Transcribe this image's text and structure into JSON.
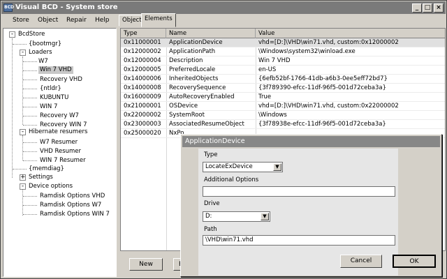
{
  "window": {
    "title": "Visual BCD - System store",
    "icon_text": "BCD",
    "icons": [
      "minimize-icon",
      "maximize-icon",
      "close-icon"
    ]
  },
  "menu": [
    "Store",
    "Object",
    "Repair",
    "Help"
  ],
  "tree": {
    "root": "BcdStore",
    "items": [
      {
        "label": "{bootmgr}"
      },
      {
        "label": "Loaders",
        "expander": "-",
        "children": [
          "W7",
          "Win 7 VHD",
          "Recovery VHD",
          "{ntldr}",
          "KUBUNTU",
          "WIN 7",
          "Recovery W7",
          "Recovery WIN 7"
        ]
      },
      {
        "label": "Hibernate resumers",
        "expander": "-",
        "children": [
          "W7 Resumer",
          "VHD Resumer",
          "WIN 7 Resumer"
        ]
      },
      {
        "label": "{memdiag}"
      },
      {
        "label": "Settings",
        "expander": "+"
      },
      {
        "label": "Device options",
        "expander": "-",
        "children": [
          "Ramdisk Options VHD",
          "Ramdisk Options W7",
          "Ramdisk Options WIN 7"
        ]
      }
    ],
    "selected": "Win 7 VHD"
  },
  "tabs": [
    "Object",
    "Elements"
  ],
  "active_tab": "Elements",
  "grid": {
    "columns": [
      "Type",
      "Name",
      "Value"
    ],
    "rows": [
      [
        "0x11000001",
        "ApplicationDevice",
        "vhd=[D:]\\VHD\\win71.vhd, custom:0x12000002"
      ],
      [
        "0x12000002",
        "ApplicationPath",
        "\\Windows\\system32\\winload.exe"
      ],
      [
        "0x12000004",
        "Description",
        "Win 7 VHD"
      ],
      [
        "0x12000005",
        "PreferredLocale",
        "en-US"
      ],
      [
        "0x14000006",
        "InheritedObjects",
        "{6efb52bf-1766-41db-a6b3-0ee5eff72bd7}"
      ],
      [
        "0x14000008",
        "RecoverySequence",
        "{3f789390-efcc-11df-96f5-001d72ceba3a}"
      ],
      [
        "0x16000009",
        "AutoRecoveryEnabled",
        "True"
      ],
      [
        "0x21000001",
        "OSDevice",
        "vhd=[D:]\\VHD\\win71.vhd, custom:0x22000002"
      ],
      [
        "0x22000002",
        "SystemRoot",
        "\\Windows"
      ],
      [
        "0x23000003",
        "AssociatedResumeObject",
        "{3f78938e-efcc-11df-96f5-001d72ceba3a}"
      ],
      [
        "0x25000020",
        "NxPo",
        ""
      ]
    ],
    "selected_row": 0
  },
  "buttons": {
    "new": "New",
    "partial": "E"
  },
  "dialog": {
    "title": "ApplicationDevice",
    "type_label": "Type",
    "type_value": "LocateExDevice",
    "additional_label": "Additional Options",
    "additional_value": "",
    "drive_label": "Drive",
    "drive_value": "D:",
    "path_label": "Path",
    "path_value": "\\VHD\\win71.vhd",
    "cancel": "Cancel",
    "ok": "OK"
  }
}
